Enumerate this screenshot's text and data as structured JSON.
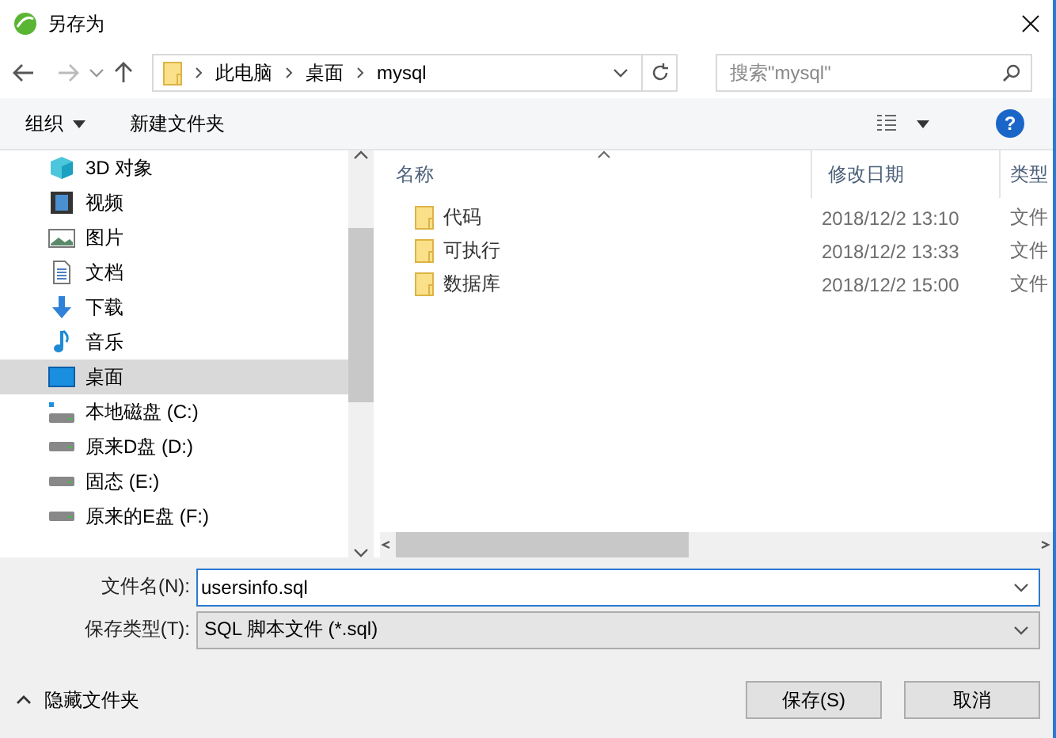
{
  "window": {
    "title": "另存为"
  },
  "nav": {
    "breadcrumb": [
      "此电脑",
      "桌面",
      "mysql"
    ],
    "search": {
      "placeholder": "搜索\"mysql\""
    }
  },
  "toolbar": {
    "organize": "组织",
    "new_folder": "新建文件夹",
    "help": "?"
  },
  "sidebar": {
    "items": [
      {
        "label": "3D 对象",
        "kind": "cube",
        "selected": false
      },
      {
        "label": "视频",
        "kind": "video",
        "selected": false
      },
      {
        "label": "图片",
        "kind": "picture",
        "selected": false
      },
      {
        "label": "文档",
        "kind": "document",
        "selected": false
      },
      {
        "label": "下载",
        "kind": "download",
        "selected": false
      },
      {
        "label": "音乐",
        "kind": "music",
        "selected": false
      },
      {
        "label": "桌面",
        "kind": "desktop",
        "selected": true
      },
      {
        "label": "本地磁盘 (C:)",
        "kind": "system-drive",
        "selected": false
      },
      {
        "label": "原来D盘 (D:)",
        "kind": "drive",
        "selected": false
      },
      {
        "label": "固态 (E:)",
        "kind": "drive",
        "selected": false
      },
      {
        "label": "原来的E盘 (F:)",
        "kind": "drive",
        "selected": false
      }
    ]
  },
  "file_list": {
    "columns": [
      "名称",
      "修改日期",
      "类型"
    ],
    "rows": [
      {
        "name": "代码",
        "modified": "2018/12/2 13:10",
        "type": "文件"
      },
      {
        "name": "可执行",
        "modified": "2018/12/2 13:33",
        "type": "文件"
      },
      {
        "name": "数据库",
        "modified": "2018/12/2 15:00",
        "type": "文件"
      }
    ]
  },
  "form": {
    "file_name": {
      "label": "文件名(N):",
      "value": "usersinfo.sql"
    },
    "file_type": {
      "label": "保存类型(T):",
      "value": "SQL 脚本文件 (*.sql)"
    }
  },
  "hide_folders": "隐藏文件夹",
  "buttons": [
    "保存(S)",
    "取消"
  ]
}
